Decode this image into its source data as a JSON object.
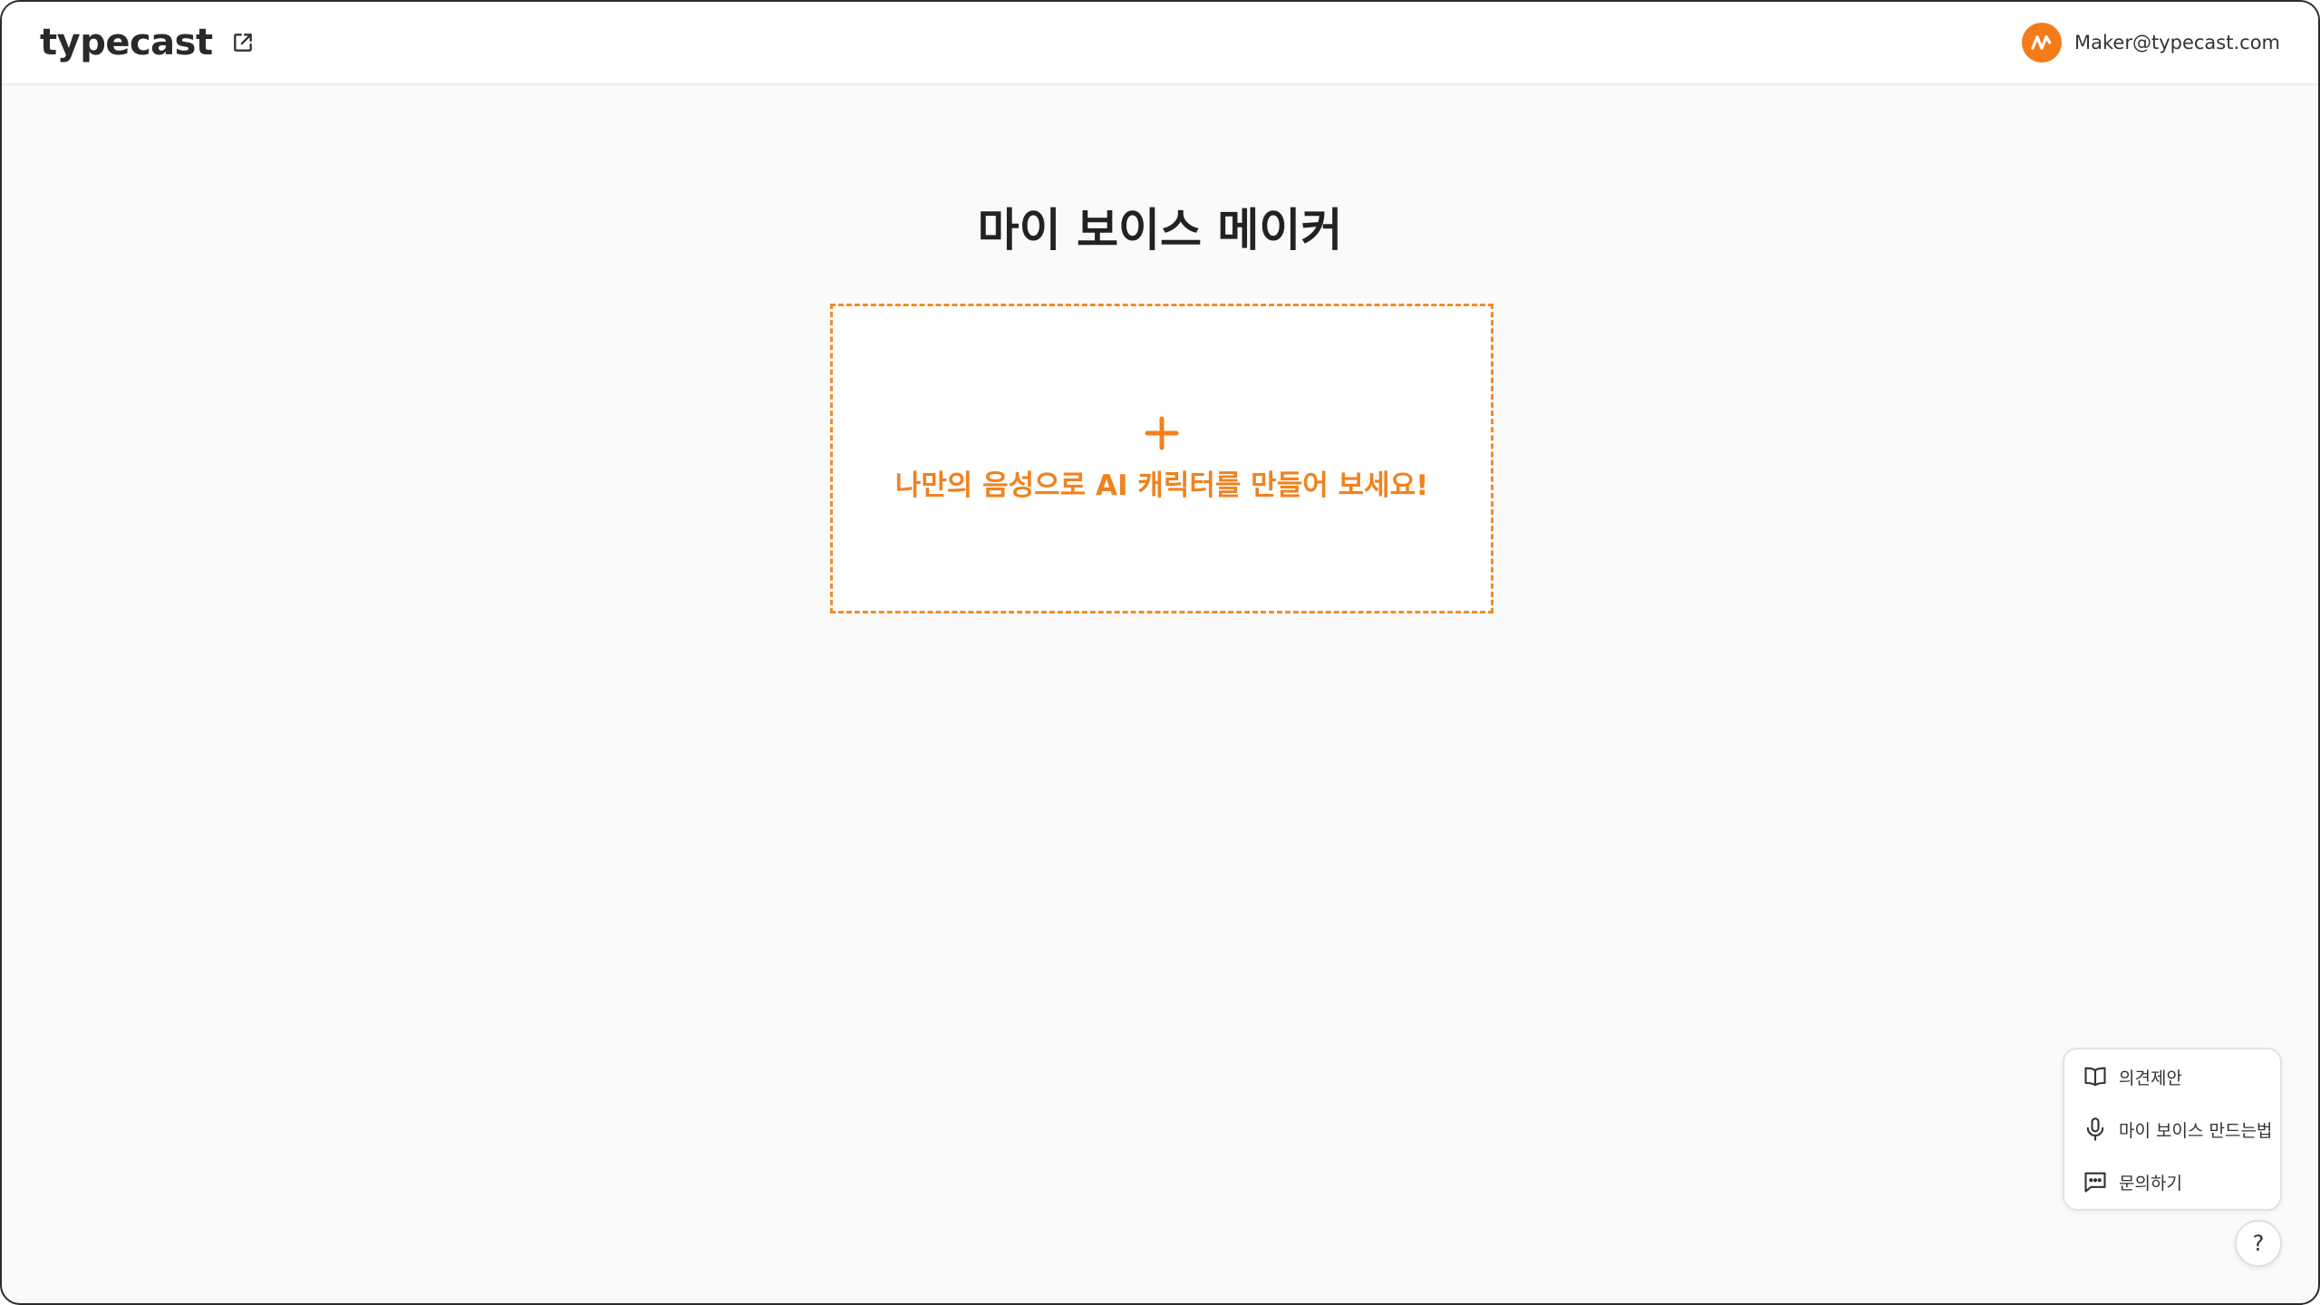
{
  "header": {
    "logo": "typecast",
    "user_email": "Maker@typecast.com"
  },
  "main": {
    "title": "마이 보이스 메이커",
    "create_prompt": "나만의 음성으로 AI 캐릭터를 만들어 보세요!"
  },
  "help_menu": {
    "items": [
      {
        "label": "의견제안",
        "icon": "book-icon"
      },
      {
        "label": "마이 보이스 만드는법",
        "icon": "microphone-icon"
      },
      {
        "label": "문의하기",
        "icon": "chat-icon"
      }
    ],
    "toggle_label": "?"
  },
  "colors": {
    "accent": "#f0821e",
    "dashed_border": "#f28a2b",
    "background": "#fafafa"
  }
}
